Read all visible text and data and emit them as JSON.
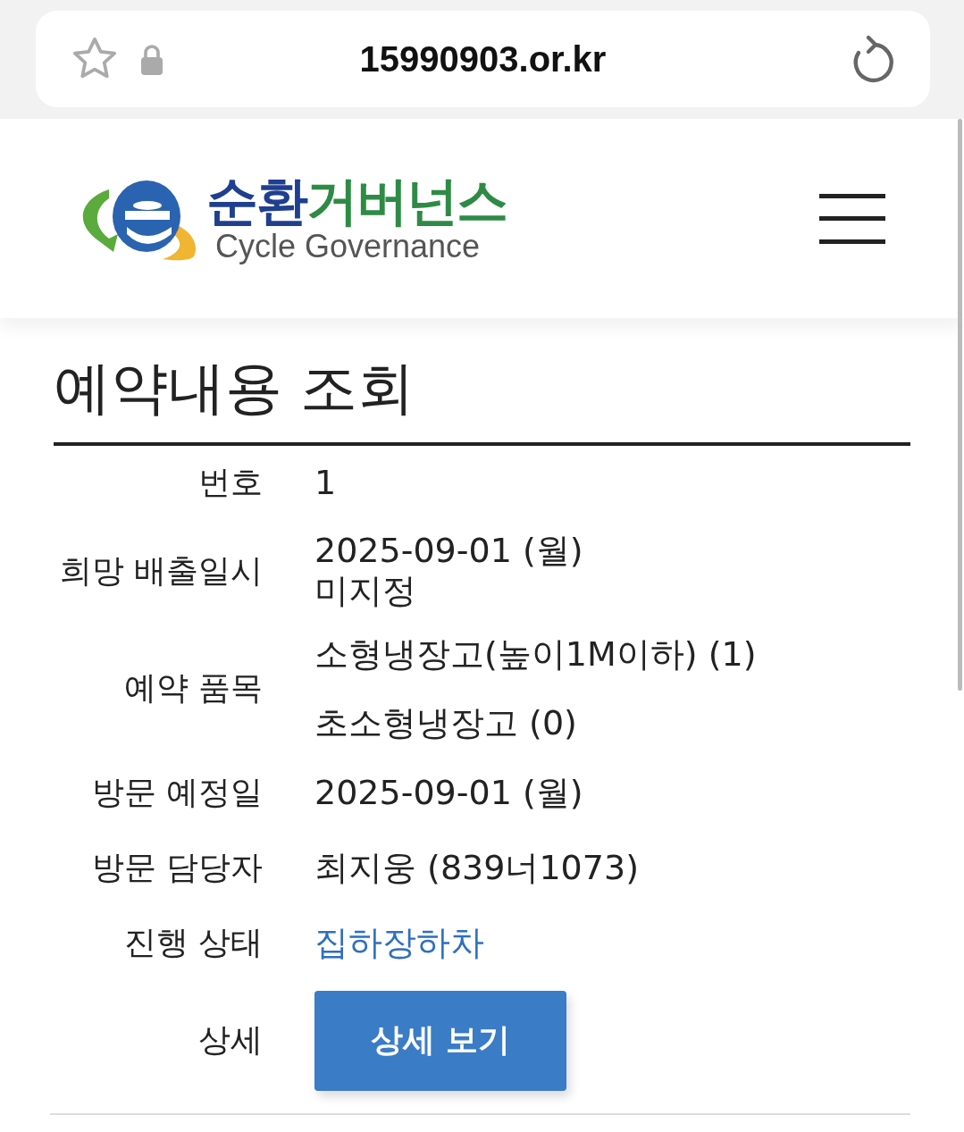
{
  "address_bar": {
    "url": "15990903.or.kr"
  },
  "logo": {
    "title": [
      {
        "text": "순환",
        "color": "#1f3f8f"
      },
      {
        "text": "거버넌스",
        "color": "#2e8b45"
      }
    ],
    "subtitle": "Cycle Governance"
  },
  "page_title": "예약내용 조회",
  "rows": [
    {
      "kind": "text",
      "label": "번호",
      "values": [
        "1"
      ]
    },
    {
      "kind": "text",
      "label": "희망 배출일시",
      "values": [
        "2025-09-01 (월)",
        "미지정"
      ]
    },
    {
      "kind": "list",
      "label": "예약 품목",
      "values": [
        "소형냉장고(높이1M이하) (1)",
        "초소형냉장고 (0)"
      ]
    },
    {
      "kind": "text",
      "label": "방문 예정일",
      "values": [
        "2025-09-01 (월)"
      ]
    },
    {
      "kind": "text",
      "label": "방문 담당자",
      "values": [
        "최지웅 (839너1073)"
      ]
    },
    {
      "kind": "status",
      "label": "진행 상태",
      "values": [
        "집하장하차"
      ]
    },
    {
      "kind": "button",
      "label": "상세",
      "values": [
        "상세 보기"
      ]
    }
  ]
}
